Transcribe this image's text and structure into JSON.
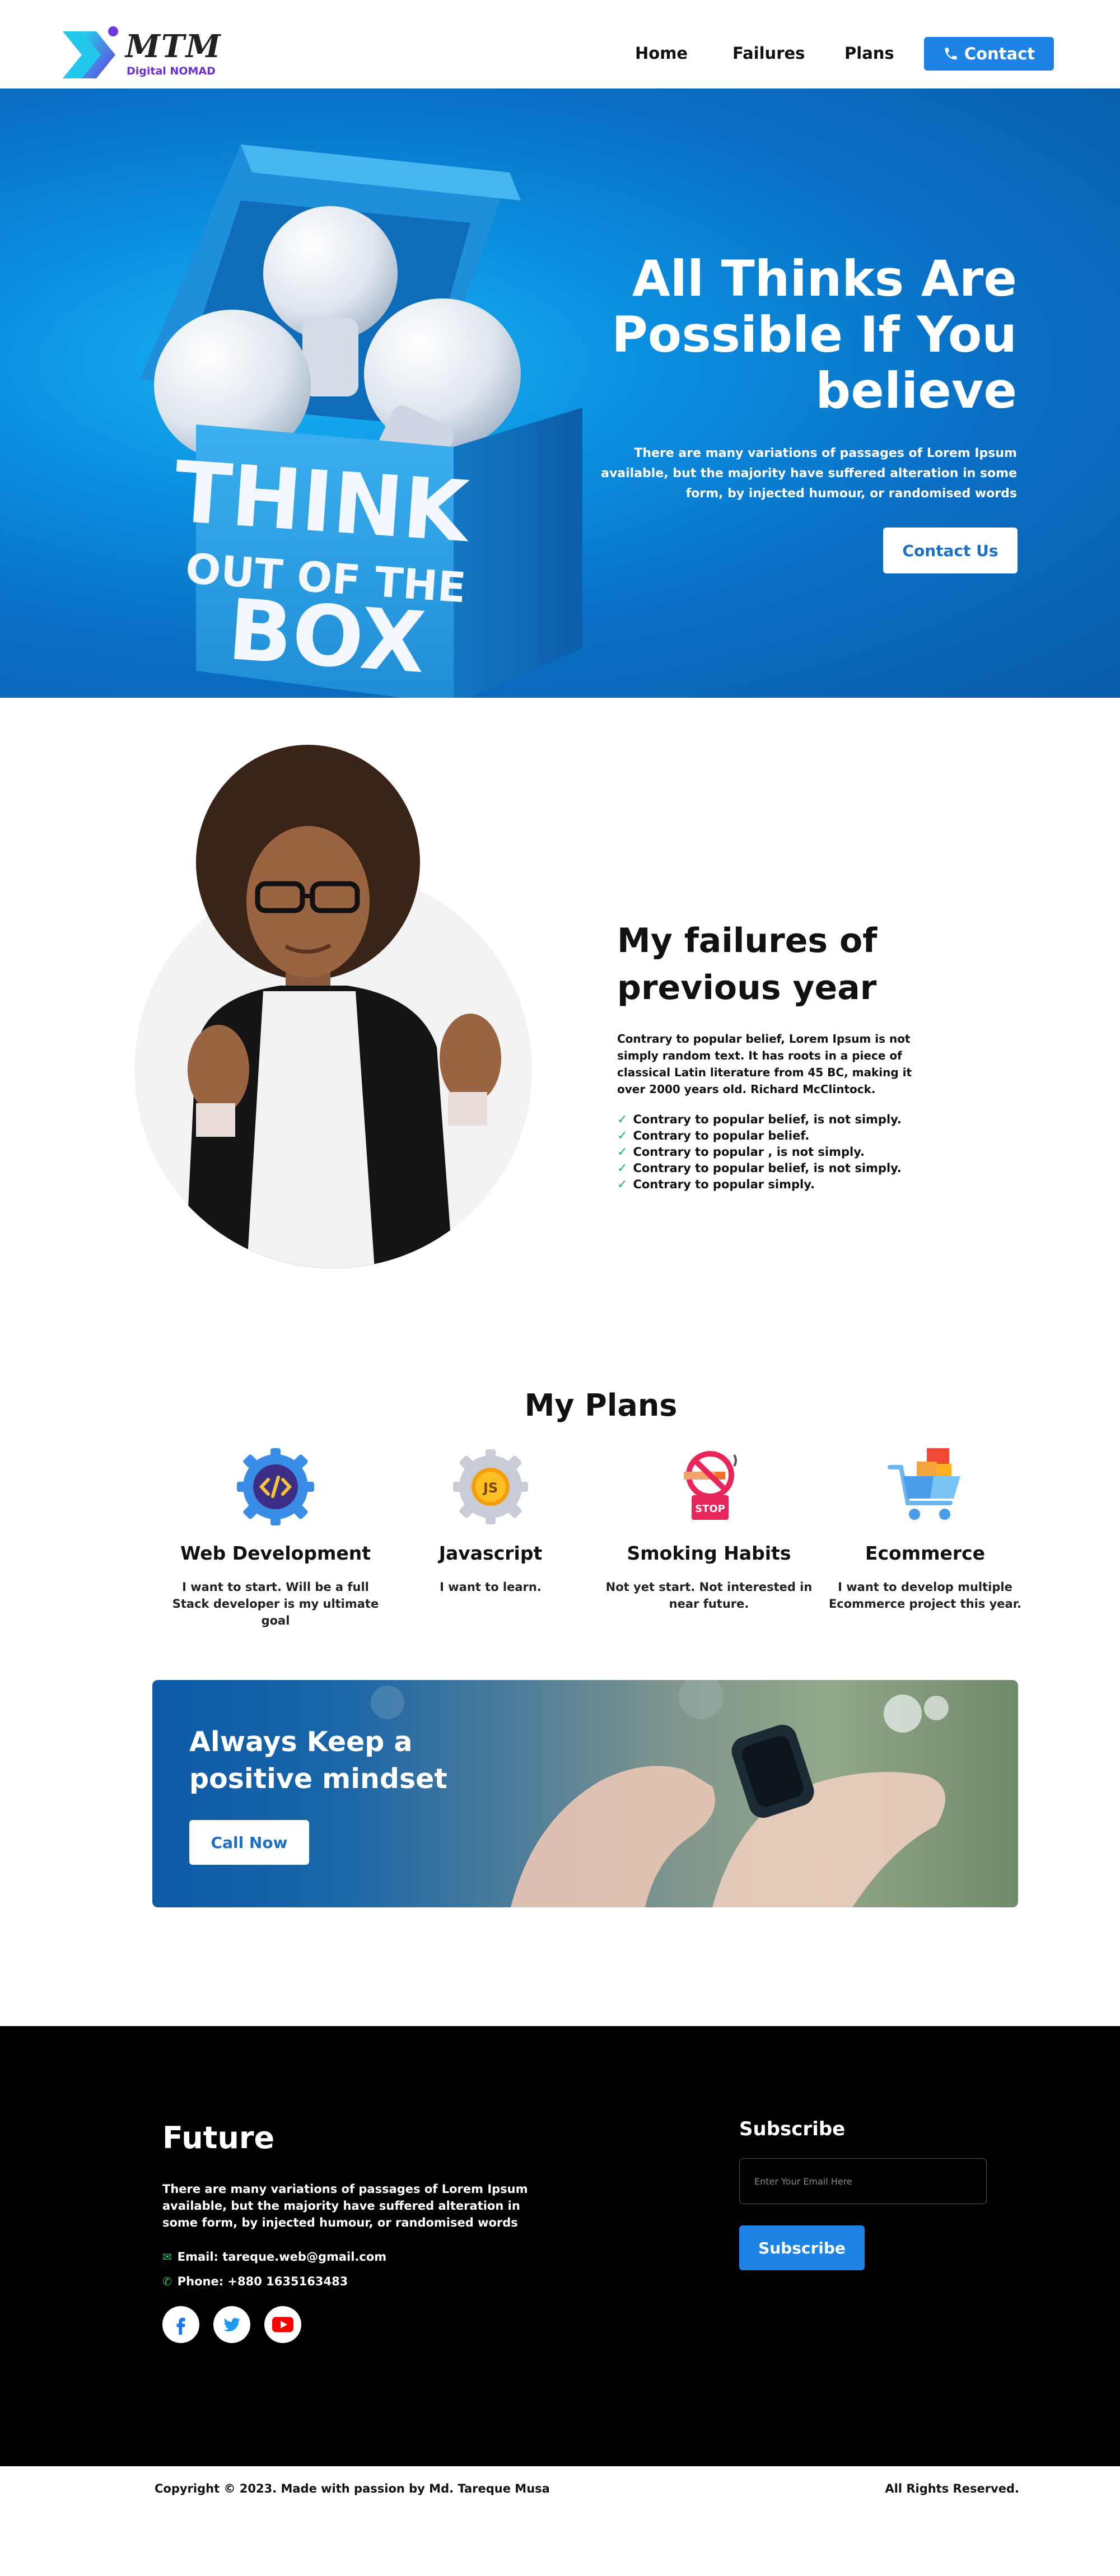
{
  "brand": {
    "name": "MTM",
    "tagline": "Digital NOMAD",
    "colors": {
      "primary": "#1d84e6",
      "brand_purple": "#6b2fd6",
      "check_green": "#1fb26a"
    }
  },
  "nav": {
    "links": [
      {
        "label": "Home"
      },
      {
        "label": "Failures"
      },
      {
        "label": "Plans"
      }
    ],
    "contact_label": "Contact",
    "contact_icon": "phone-icon"
  },
  "hero": {
    "title": "All Thinks Are Possible If You believe",
    "text": "There are many variations of passages of Lorem Ipsum available, but the majority have suffered alteration in some form, by injected humour, or randomised words",
    "button_label": "Contact Us",
    "box_lines": [
      "THINK",
      "OUT OF THE",
      "BOX"
    ]
  },
  "failures": {
    "title": "My failures of previous year",
    "text": "Contrary to popular belief, Lorem Ipsum is not simply random text. It has roots in a piece of classical Latin literature from 45 BC, making it over 2000 years old. Richard McClintock.",
    "items": [
      "Contrary to popular belief, is not simply.",
      "Contrary to popular belief.",
      "Contrary to popular , is not simply.",
      "Contrary to popular belief, is not simply.",
      "Contrary to popular simply."
    ]
  },
  "plans": {
    "title": "My Plans",
    "items": [
      {
        "title": "Web Development",
        "desc": "I want to start. Will be a full Stack developer is my ultimate goal",
        "icon": "code-gear-icon"
      },
      {
        "title": "Javascript",
        "desc": "I want to learn.",
        "icon": "js-gear-icon"
      },
      {
        "title": "Smoking Habits",
        "desc": "Not yet start. Not interested in near future.",
        "icon": "no-smoking-icon"
      },
      {
        "title": "Ecommerce",
        "desc": "I want to develop multiple Ecommerce project this year.",
        "icon": "shopping-cart-icon"
      }
    ]
  },
  "cta": {
    "title": "Always Keep a positive mindset",
    "button_label": "Call Now"
  },
  "footer": {
    "title": "Future",
    "text": "There are many variations of passages of Lorem Ipsum available, but the majority have suffered alteration in some form, by injected humour, or randomised words",
    "email": "Email: tareque.web@gmail.com",
    "phone": "Phone: +880 1635163483",
    "social": [
      "facebook-icon",
      "twitter-icon",
      "youtube-icon"
    ],
    "subscribe_title": "Subscribe",
    "email_placeholder": "Enter Your Email Here",
    "subscribe_button": "Subscribe"
  },
  "bottom": {
    "copyright": "Copyright © 2023. Made with passion by Md. Tareque Musa",
    "rights": "All Rights Reserved."
  }
}
